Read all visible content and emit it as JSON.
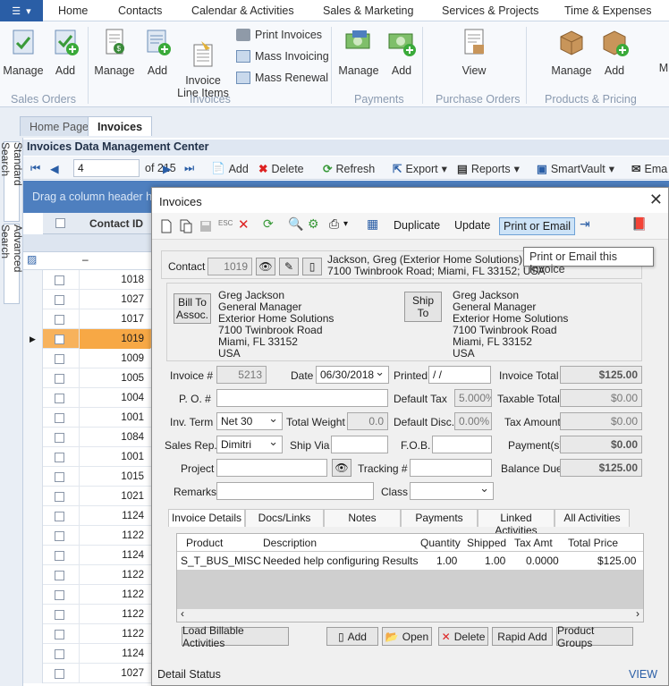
{
  "menu": {
    "app_icon": "menu-grid-icon",
    "items": [
      "Home",
      "Contacts",
      "Calendar & Activities",
      "Sales & Marketing",
      "Services & Projects",
      "Time & Expenses"
    ]
  },
  "ribbon": {
    "sales_orders": {
      "group": "Sales Orders",
      "manage": "Manage",
      "add": "Add"
    },
    "invoices": {
      "group": "Invoices",
      "manage": "Manage",
      "add": "Add",
      "line_items": "Invoice\nLine Items",
      "print": "Print Invoices",
      "mass_invoicing": "Mass Invoicing",
      "mass_renewal": "Mass Renewal"
    },
    "payments": {
      "group": "Payments",
      "manage": "Manage",
      "add": "Add"
    },
    "purchase_orders": {
      "group": "Purchase Orders",
      "view": "View"
    },
    "products": {
      "group": "Products & Pricing",
      "manage": "Manage",
      "add": "Add",
      "more": "M"
    }
  },
  "tabs": [
    "Home Page",
    "Invoices"
  ],
  "side_tabs": [
    "Standard Search",
    "Advanced Search"
  ],
  "datacenter": {
    "title": "Invoices Data Management Center",
    "record": "4",
    "of_total": "of 215",
    "add": "Add",
    "delete": "Delete",
    "refresh": "Refresh",
    "export": "Export",
    "reports": "Reports",
    "smartvault": "SmartVault",
    "email": "Ema",
    "group_hint": "Drag a column header he",
    "contact_id_header": "Contact ID",
    "filter_dash": "–"
  },
  "grid_rows": [
    "1018",
    "1027",
    "1017",
    "1019",
    "1009",
    "1005",
    "1004",
    "1001",
    "1084",
    "1001",
    "1015",
    "1021",
    "1124",
    "1122",
    "1124",
    "1122",
    "1122",
    "1122",
    "1122",
    "1124",
    "1027"
  ],
  "selected_row_index": 3,
  "dialog": {
    "title": "Invoices",
    "toolbar": {
      "duplicate": "Duplicate",
      "update": "Update",
      "print_email": "Print or Email"
    },
    "tooltip": "Print or Email this Invoice",
    "contact": {
      "label": "Contact",
      "id": "1019",
      "name": "Jackson, Greg (Exterior Home Solutions)",
      "address": "7100 Twinbrook Road; Miami, FL 33152; USA"
    },
    "bill_to": {
      "button": "Bill To\nAssoc.",
      "lines": "Greg Jackson\nGeneral Manager\nExterior Home Solutions\n7100 Twinbrook Road\nMiami, FL 33152\nUSA"
    },
    "ship_to": {
      "button": "Ship\nTo",
      "lines": "Greg Jackson\nGeneral Manager\nExterior Home Solutions\n7100 Twinbrook Road\nMiami, FL 33152\nUSA"
    },
    "fields": {
      "invoice_no_label": "Invoice #",
      "invoice_no": "5213",
      "date_label": "Date",
      "date": "06/30/2018",
      "printed_label": "Printed",
      "printed": " /  /",
      "invoice_total_label": "Invoice Total",
      "invoice_total": "$125.00",
      "po_label": "P. O. #",
      "po": "",
      "default_tax_label": "Default Tax",
      "default_tax": "5.000%",
      "taxable_total_label": "Taxable Total",
      "taxable_total": "$0.00",
      "inv_term_label": "Inv. Term",
      "inv_term": "Net 30",
      "total_weight_label": "Total Weight",
      "total_weight": "0.0",
      "default_disc_label": "Default Disc.",
      "default_disc": "0.00%",
      "tax_amount_label": "Tax Amount",
      "tax_amount": "$0.00",
      "sales_rep_label": "Sales Rep.",
      "sales_rep": "Dimitri",
      "ship_via_label": "Ship Via",
      "ship_via": "",
      "fob_label": "F.O.B.",
      "fob": "",
      "payments_label": "Payment(s)",
      "payments": "$0.00",
      "project_label": "Project",
      "project": "",
      "tracking_label": "Tracking #",
      "tracking": "",
      "balance_due_label": "Balance Due",
      "balance_due": "$125.00",
      "remarks_label": "Remarks",
      "remarks": "",
      "class_label": "Class",
      "class": ""
    },
    "detail_tabs": [
      "Invoice Details",
      "Docs/Links",
      "Notes",
      "Payments",
      "Linked Activities",
      "All Activities"
    ],
    "items": {
      "headers": [
        "Product",
        "Description",
        "Quantity",
        "Shipped",
        "Tax Amt",
        "Total Price"
      ],
      "rows": [
        [
          "S_T_BUS_MISC",
          "Needed help configuring Results",
          "1.00",
          "1.00",
          "0.0000",
          "$125.00"
        ]
      ]
    },
    "buttons": {
      "load_billable": "Load Billable Activities",
      "add": "Add",
      "open": "Open",
      "delete": "Delete",
      "rapid_add": "Rapid Add",
      "product_groups": "Product Groups"
    },
    "status": {
      "label": "Detail Status",
      "view": "VIEW"
    }
  },
  "colors": {
    "accent": "#2a5ea6",
    "selected_row": "#f7a845",
    "group_band": "#4e7fbf"
  }
}
